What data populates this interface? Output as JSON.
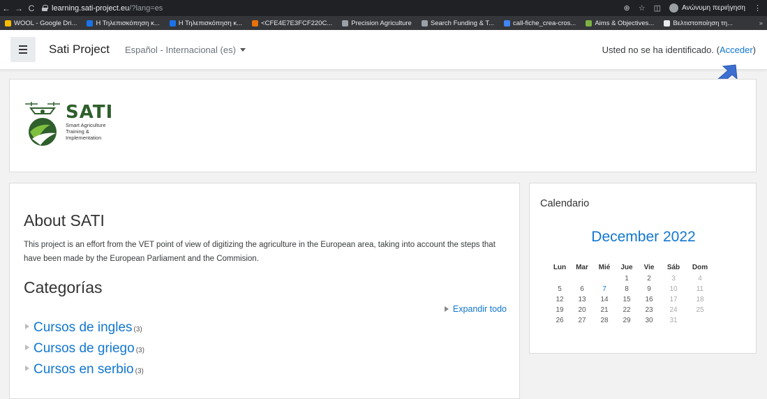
{
  "browser": {
    "url_host": "learning.sati-project.eu",
    "url_path": "/?lang=es",
    "profile_label": "Ανώνυμη περιήγηση",
    "bookmarks": [
      {
        "label": "WOOL - Google Dri...",
        "color": "#fbbc04"
      },
      {
        "label": "Η Τηλεπισκόπηση κ...",
        "color": "#1a73e8"
      },
      {
        "label": "Η Τηλεπισκόπηση κ...",
        "color": "#1a73e8"
      },
      {
        "label": "<CFE4E7E3FCF220C...",
        "color": "#e8710a"
      },
      {
        "label": "Precision Agriculture",
        "color": "#9aa0a6"
      },
      {
        "label": "Search Funding & T...",
        "color": "#9aa0a6"
      },
      {
        "label": "call-fiche_crea-cros...",
        "color": "#4285f4"
      },
      {
        "label": "Aims & Objectives...",
        "color": "#7cb342"
      },
      {
        "label": "Βελτιστοποίηση τη...",
        "color": "#e8eaed"
      }
    ],
    "more": "»"
  },
  "navbar": {
    "brand": "Sati Project",
    "language": "Español - Internacional (es)",
    "login_text": "Usted no se ha identificado. (",
    "login_link": "Acceder",
    "login_close": ")"
  },
  "logo": {
    "title": "SATI",
    "line1": "Smart Agriculture",
    "line2": "Training &",
    "line3": "Implementation"
  },
  "about": {
    "title": "About SATI",
    "text": "This project is an effort from the VET  point of view of digitizing the agriculture in the European area, taking into account the steps that have been made by the European Parliament and the Commision."
  },
  "categories": {
    "title": "Categorías",
    "expand_label": "Expandir todo",
    "items": [
      {
        "name": "Cursos de ingles",
        "count": "(3)"
      },
      {
        "name": "Cursos de griego",
        "count": "(3)"
      },
      {
        "name": "Cursos en serbio",
        "count": "(3)"
      }
    ]
  },
  "calendar": {
    "title": "Calendario",
    "month": "December 2022",
    "days": [
      "Lun",
      "Mar",
      "Mié",
      "Jue",
      "Vie",
      "Sáb",
      "Dom"
    ],
    "weeks": [
      [
        "",
        "",
        "",
        "1",
        "2",
        "3",
        "4"
      ],
      [
        "5",
        "6",
        "7",
        "8",
        "9",
        "10",
        "11"
      ],
      [
        "12",
        "13",
        "14",
        "15",
        "16",
        "17",
        "18"
      ],
      [
        "19",
        "20",
        "21",
        "22",
        "23",
        "24",
        "25"
      ],
      [
        "26",
        "27",
        "28",
        "29",
        "30",
        "31",
        ""
      ]
    ],
    "event_day": "7"
  },
  "colors": {
    "link": "#1177d1",
    "brand_green": "#2f5f2c",
    "annotation_arrow": "#3d6fd1"
  }
}
